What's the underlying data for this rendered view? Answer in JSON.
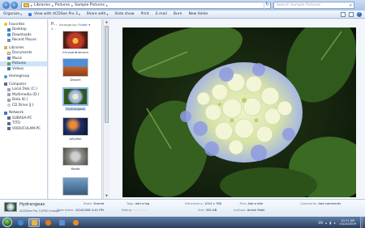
{
  "window": {
    "breadcrumb": [
      "Libraries",
      "Pictures",
      "Sample Pictures"
    ],
    "search_placeholder": "Search Sample Pictures"
  },
  "toolbar": {
    "organize": "Organize",
    "view_with": "View with ACDSee Pro 3",
    "share_with": "Share with",
    "slide_show": "Slide show",
    "print": "Print",
    "email": "E-mail",
    "burn": "Burn",
    "new_folder": "New folder"
  },
  "navpane": {
    "favorites": {
      "label": "Favorites",
      "items": [
        "Desktop",
        "Downloads",
        "Recent Places"
      ]
    },
    "libraries": {
      "label": "Libraries",
      "items": [
        "Documents",
        "Music",
        "Pictures",
        "Videos"
      ]
    },
    "homegroup": "Homegroup",
    "computer": {
      "label": "Computer",
      "items": [
        "Local Disk (C:)",
        "Multimedia (D:)",
        "Data (E:)",
        "CD Drive (J:)"
      ]
    },
    "network": {
      "label": "Network",
      "items": [
        "SUBASA-PC",
        "TITO",
        "VODUCULAM-PC"
      ]
    }
  },
  "library": {
    "title": "P...",
    "subtitle": "S...",
    "arrange_label": "Arrange by:",
    "arrange_value": "Folder"
  },
  "files": [
    {
      "name": "Chrysanthemum",
      "selected": false
    },
    {
      "name": "Desert",
      "selected": false
    },
    {
      "name": "Hydrangeas",
      "selected": true
    },
    {
      "name": "Jellyfish",
      "selected": false
    },
    {
      "name": "Koala",
      "selected": false
    }
  ],
  "details": {
    "name": "Hydrangeas",
    "type": "ACDSee Pro 3 JPEG Image",
    "date_taken_label": "Date taken:",
    "date_taken": "3/24/2008 4:41 PM",
    "state_label": "State:",
    "state": "Shared",
    "tags_label": "Tags:",
    "tags": "Add a tag",
    "rating_label": "Rating:",
    "rating": 0,
    "rating_max": 5,
    "dimensions_label": "Dimensions:",
    "dimensions": "1024 x 768",
    "size_label": "Size:",
    "size": "581 KB",
    "title_label": "Title:",
    "title": "Add a title",
    "authors_label": "Authors:",
    "authors": "Amish Patel",
    "comments_label": "Comments:",
    "comments": "Add comments"
  },
  "taskbar": {
    "time": "10:11 AM",
    "date": "10/24/2009",
    "lang": "EN"
  }
}
